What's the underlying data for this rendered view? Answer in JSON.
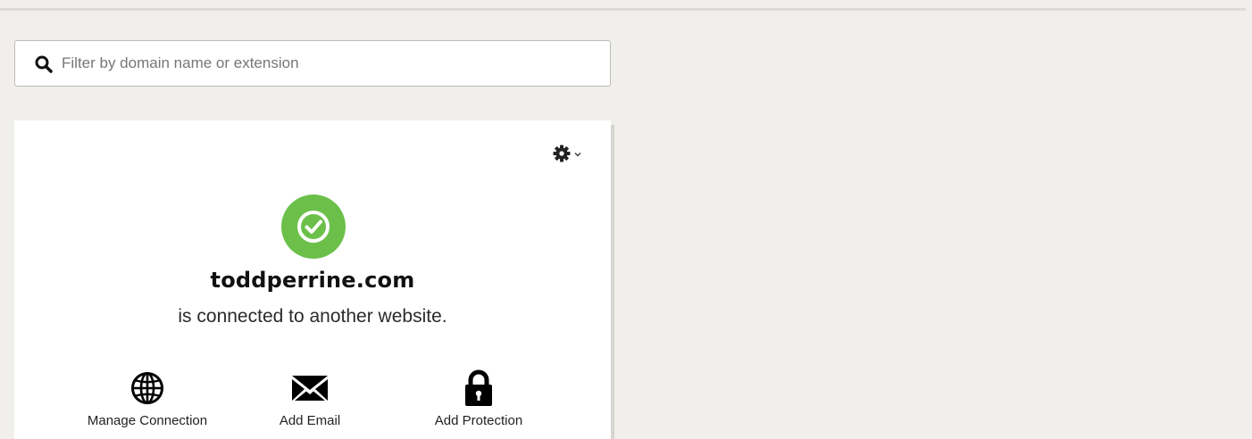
{
  "search": {
    "placeholder": "Filter by domain name or extension",
    "value": ""
  },
  "domain_card": {
    "domain": "toddperrine.com",
    "status": "is connected to another website.",
    "status_color": "#6cc04a",
    "settings_icon": "gear-icon",
    "actions": [
      {
        "label": "Manage Connection",
        "icon": "globe-icon"
      },
      {
        "label": "Add Email",
        "icon": "envelope-icon"
      },
      {
        "label": "Add Protection",
        "icon": "lock-icon"
      }
    ]
  }
}
